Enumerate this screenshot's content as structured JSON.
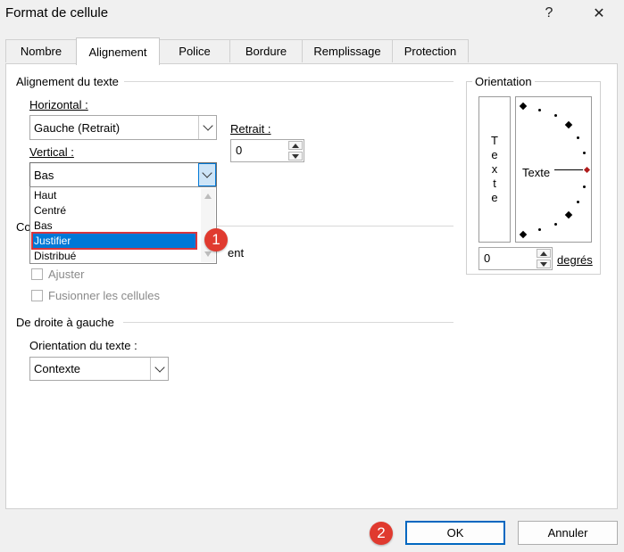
{
  "window": {
    "title": "Format de cellule",
    "help": "?",
    "close": "✕"
  },
  "tabs": [
    {
      "label": "Nombre"
    },
    {
      "label": "Alignement"
    },
    {
      "label": "Police"
    },
    {
      "label": "Bordure"
    },
    {
      "label": "Remplissage"
    },
    {
      "label": "Protection"
    }
  ],
  "alignment": {
    "title": "Alignement du texte",
    "horizontal_label": "Horizontal :",
    "horizontal_value": "Gauche (Retrait)",
    "indent_label": "Retrait :",
    "indent_value": "0",
    "vertical_label": "Vertical :",
    "vertical_value": "Bas",
    "vertical_options": [
      "Haut",
      "Centré",
      "Bas",
      "Justifier",
      "Distribué"
    ],
    "selected_option": "Justifier"
  },
  "control": {
    "title_partial": "Co",
    "hidden_checkbox_partial": "ent",
    "shrink_label": "Ajuster",
    "merge_label": "Fusionner les cellules"
  },
  "rtl": {
    "title": "De droite à gauche",
    "direction_label": "Orientation du texte :",
    "direction_value": "Contexte"
  },
  "orientation": {
    "title": "Orientation",
    "vertical_text": [
      "T",
      "e",
      "x",
      "t",
      "e"
    ],
    "dial_text": "Texte",
    "degrees_value": "0",
    "degrees_label": "degrés"
  },
  "buttons": {
    "ok": "OK",
    "cancel": "Annuler"
  },
  "badges": {
    "one": "1",
    "two": "2"
  },
  "colors": {
    "selection": "#0078d7",
    "badge": "#e03a2f",
    "highlight_border": "#d9363e",
    "ok_border": "#0067c0"
  }
}
